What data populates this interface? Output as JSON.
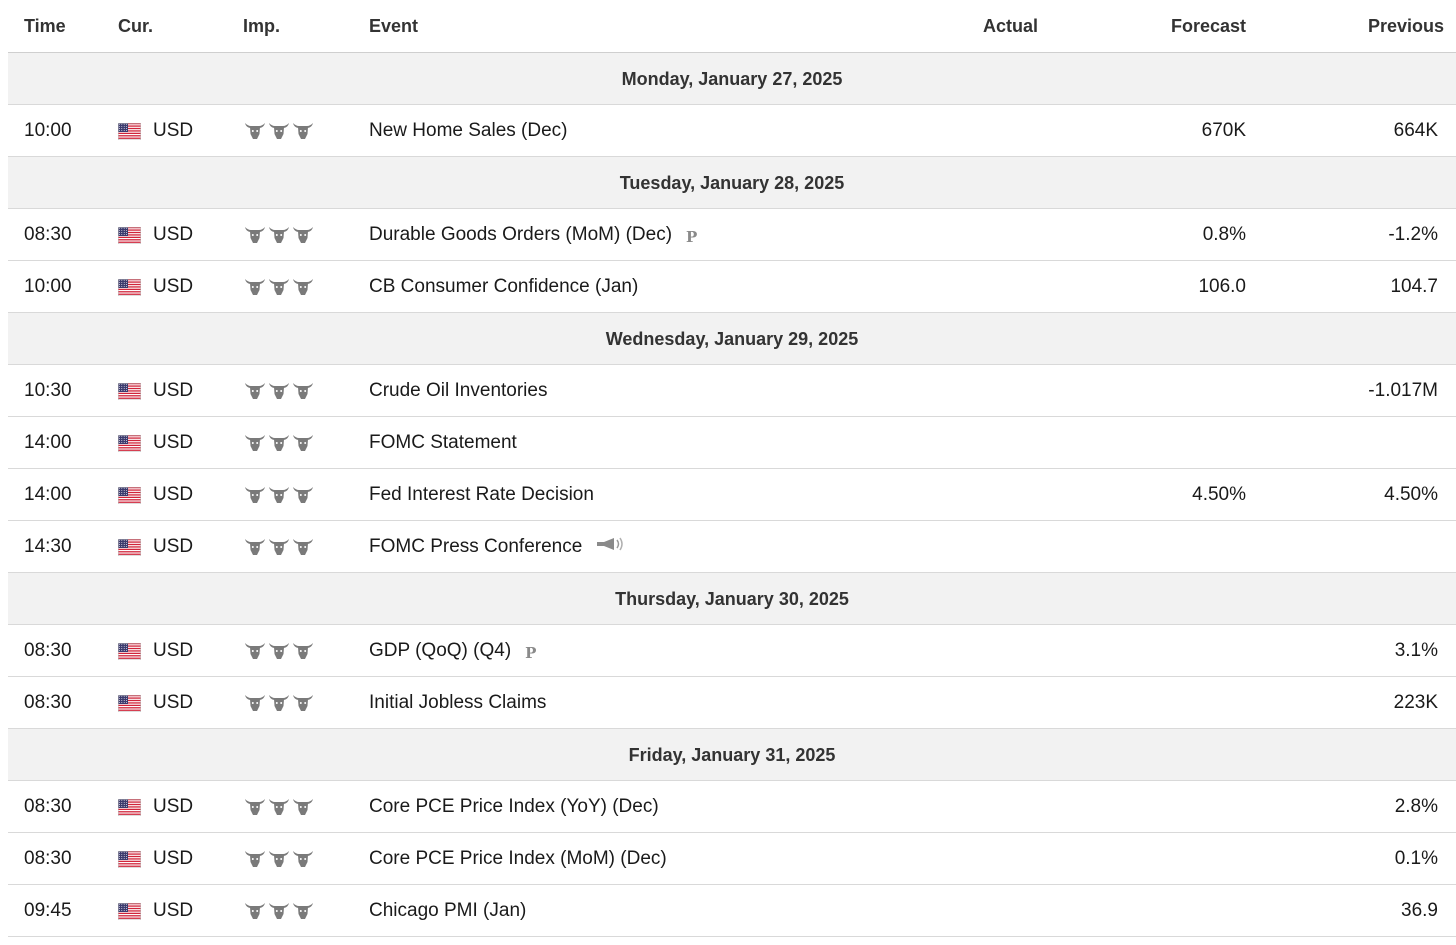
{
  "columns": {
    "time": "Time",
    "currency": "Cur.",
    "importance": "Imp.",
    "event": "Event",
    "actual": "Actual",
    "forecast": "Forecast",
    "previous": "Previous"
  },
  "colors": {
    "date_row_bg": "#f2f2f2",
    "border": "#d9d9d9",
    "importance_icon": "#7a7a7a"
  },
  "days": [
    {
      "date": "Monday, January 27, 2025",
      "events": [
        {
          "time": "10:00",
          "currency": "USD",
          "importance": 3,
          "event": "New Home Sales (Dec)",
          "badge": "",
          "actual": "",
          "forecast": "670K",
          "previous": "664K"
        }
      ]
    },
    {
      "date": "Tuesday, January 28, 2025",
      "events": [
        {
          "time": "08:30",
          "currency": "USD",
          "importance": 3,
          "event": "Durable Goods Orders (MoM) (Dec)",
          "badge": "preliminary-icon",
          "actual": "",
          "forecast": "0.8%",
          "previous": "-1.2%"
        },
        {
          "time": "10:00",
          "currency": "USD",
          "importance": 3,
          "event": "CB Consumer Confidence (Jan)",
          "badge": "",
          "actual": "",
          "forecast": "106.0",
          "previous": "104.7"
        }
      ]
    },
    {
      "date": "Wednesday, January 29, 2025",
      "events": [
        {
          "time": "10:30",
          "currency": "USD",
          "importance": 3,
          "event": "Crude Oil Inventories",
          "badge": "",
          "actual": "",
          "forecast": "",
          "previous": "-1.017M"
        },
        {
          "time": "14:00",
          "currency": "USD",
          "importance": 3,
          "event": "FOMC Statement",
          "badge": "",
          "actual": "",
          "forecast": "",
          "previous": ""
        },
        {
          "time": "14:00",
          "currency": "USD",
          "importance": 3,
          "event": "Fed Interest Rate Decision",
          "badge": "",
          "actual": "",
          "forecast": "4.50%",
          "previous": "4.50%"
        },
        {
          "time": "14:30",
          "currency": "USD",
          "importance": 3,
          "event": "FOMC Press Conference",
          "badge": "speech-megaphone-icon",
          "actual": "",
          "forecast": "",
          "previous": ""
        }
      ]
    },
    {
      "date": "Thursday, January 30, 2025",
      "events": [
        {
          "time": "08:30",
          "currency": "USD",
          "importance": 3,
          "event": "GDP (QoQ) (Q4)",
          "badge": "preliminary-icon",
          "actual": "",
          "forecast": "",
          "previous": "3.1%"
        },
        {
          "time": "08:30",
          "currency": "USD",
          "importance": 3,
          "event": "Initial Jobless Claims",
          "badge": "",
          "actual": "",
          "forecast": "",
          "previous": "223K"
        }
      ]
    },
    {
      "date": "Friday, January 31, 2025",
      "events": [
        {
          "time": "08:30",
          "currency": "USD",
          "importance": 3,
          "event": "Core PCE Price Index (YoY) (Dec)",
          "badge": "",
          "actual": "",
          "forecast": "",
          "previous": "2.8%"
        },
        {
          "time": "08:30",
          "currency": "USD",
          "importance": 3,
          "event": "Core PCE Price Index (MoM) (Dec)",
          "badge": "",
          "actual": "",
          "forecast": "",
          "previous": "0.1%"
        },
        {
          "time": "09:45",
          "currency": "USD",
          "importance": 3,
          "event": "Chicago PMI (Jan)",
          "badge": "",
          "actual": "",
          "forecast": "",
          "previous": "36.9"
        }
      ]
    }
  ]
}
